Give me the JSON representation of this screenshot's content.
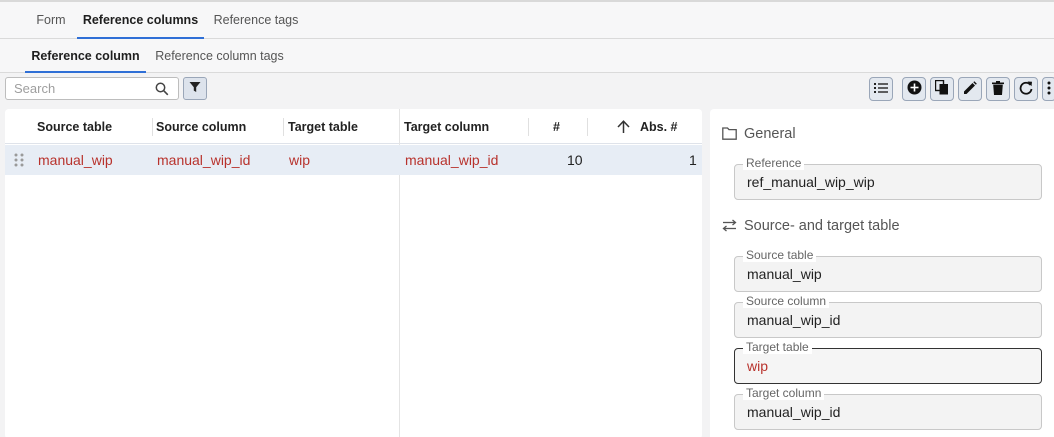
{
  "tabs": [
    {
      "label": "Form",
      "active": false
    },
    {
      "label": "Reference columns",
      "active": true
    },
    {
      "label": "Reference tags",
      "active": false
    }
  ],
  "subtabs": [
    {
      "label": "Reference column",
      "active": true
    },
    {
      "label": "Reference column tags",
      "active": false
    }
  ],
  "search": {
    "placeholder": "Search",
    "value": ""
  },
  "toolbar": {
    "icons": [
      "list-icon",
      "add-circle-icon",
      "copy-icon",
      "edit-icon",
      "delete-icon",
      "refresh-icon",
      "more-icon"
    ]
  },
  "table": {
    "columns": [
      "Source table",
      "Source column",
      "Target table",
      "Target column",
      "#",
      "Abs. #"
    ],
    "sort": {
      "column": "Abs. #",
      "direction": "ascending"
    },
    "rows": [
      {
        "source_table": "manual_wip",
        "source_column": "manual_wip_id",
        "target_table": "wip",
        "target_column": "manual_wip_id",
        "num": "10",
        "abs_num": "1"
      }
    ]
  },
  "form": {
    "general_title": "General",
    "reference_label": "Reference",
    "reference_value": "ref_manual_wip_wip",
    "source_target_title": "Source- and target table",
    "source_table_label": "Source table",
    "source_table_value": "manual_wip",
    "source_column_label": "Source column",
    "source_column_value": "manual_wip_id",
    "target_table_label": "Target table",
    "target_table_value": "wip",
    "target_column_label": "Target column",
    "target_column_value": "manual_wip_id"
  },
  "colors": {
    "accent": "#2f6fd6",
    "link": "#b8322c",
    "selected_row": "#e7edf5",
    "button_bg": "#e3e8ef"
  }
}
